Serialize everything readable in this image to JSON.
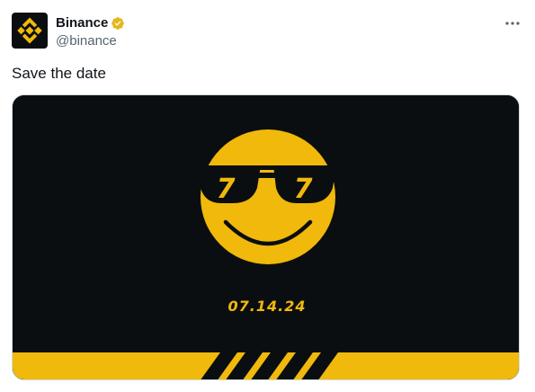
{
  "account": {
    "display_name": "Binance",
    "handle": "@binance",
    "verified": true,
    "avatar_icon": "binance-logo-icon"
  },
  "menu": {
    "icon": "more-horizontal-icon"
  },
  "tweet": {
    "text": "Save the date"
  },
  "media": {
    "date_text": "07.14.24",
    "glasses_left_number": "7",
    "glasses_right_number": "7",
    "colors": {
      "background": "#0b0e11",
      "accent": "#f0b90b",
      "stripe_dark": "#0b0e11"
    }
  },
  "colors": {
    "text_primary": "#0f1419",
    "text_secondary": "#536471",
    "verified_gold": "#e2b719"
  }
}
